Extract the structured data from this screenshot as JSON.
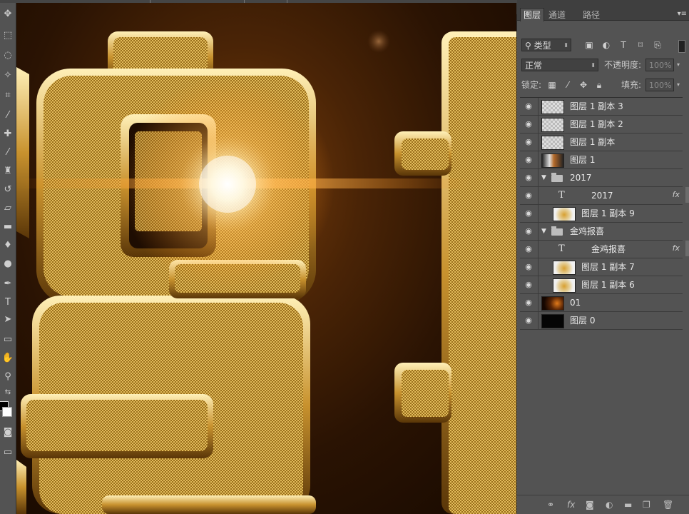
{
  "panel": {
    "tabs": [
      "图层",
      "通道",
      "路径"
    ],
    "filter_kind": "类型",
    "blend_mode": "正常",
    "opacity_label": "不透明度:",
    "opacity_value": "100%",
    "lock_label": "锁定:",
    "fill_label": "填充:",
    "fill_value": "100%"
  },
  "layers": [
    {
      "name": "图层 1 副本 3",
      "kind": "pixel",
      "thumb": "checker",
      "indent": 0
    },
    {
      "name": "图层 1 副本 2",
      "kind": "pixel",
      "thumb": "checker",
      "indent": 0
    },
    {
      "name": "图层 1 副本",
      "kind": "pixel",
      "thumb": "checker",
      "indent": 0
    },
    {
      "name": "图层 1",
      "kind": "pixel",
      "thumb": "strip",
      "indent": 0
    },
    {
      "name": "2017",
      "kind": "group",
      "indent": 0
    },
    {
      "name": "2017",
      "kind": "text",
      "glyph": "T",
      "fx": "fx",
      "indent": 1
    },
    {
      "name": "图层 1 副本 9",
      "kind": "pixel",
      "thumb": "gold",
      "indent": 1
    },
    {
      "name": "金鸡报喜",
      "kind": "group",
      "indent": 0
    },
    {
      "name": "金鸡报喜",
      "kind": "text",
      "glyph": "T",
      "fx": "fx",
      "indent": 1
    },
    {
      "name": "图层 1 副本 7",
      "kind": "pixel",
      "thumb": "gold",
      "indent": 1
    },
    {
      "name": "图层 1 副本 6",
      "kind": "pixel",
      "thumb": "gold",
      "indent": 1
    },
    {
      "name": "01",
      "kind": "pixel",
      "thumb": "fire",
      "indent": 0
    },
    {
      "name": "图层 0",
      "kind": "pixel",
      "thumb": "dark",
      "indent": 0
    }
  ],
  "icons": {
    "eye": "eye-icon",
    "group": "folder-icon",
    "link": "link-icon",
    "fx": "fx-icon",
    "mask": "mask-icon",
    "adjust": "adjustment-icon",
    "new_group": "new-group-icon",
    "new_layer": "new-layer-icon",
    "trash": "trash-icon"
  },
  "colors": {
    "panel_bg": "#535353",
    "gold": "#d9a640",
    "glow": "#ffb24a"
  }
}
